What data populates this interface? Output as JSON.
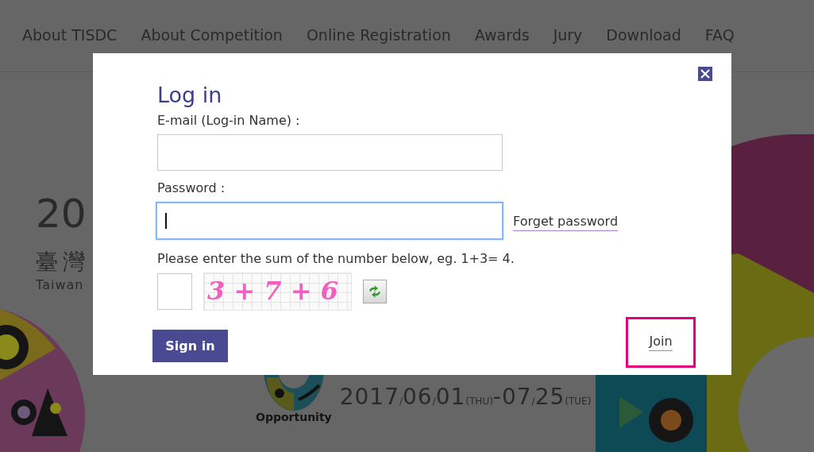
{
  "nav": {
    "items": [
      {
        "label": "About TISDC"
      },
      {
        "label": "About Competition"
      },
      {
        "label": "Online Registration"
      },
      {
        "label": "Awards"
      },
      {
        "label": "Jury"
      },
      {
        "label": "Download"
      },
      {
        "label": "FAQ"
      }
    ]
  },
  "hero": {
    "year": "20",
    "title_zh": "臺灣",
    "title_en": "Taiwan",
    "logo_caption": "Opportunity",
    "date": [
      {
        "text": "2017",
        "small": false
      },
      {
        "text": "/",
        "small": true
      },
      {
        "text": "06",
        "small": false
      },
      {
        "text": "/",
        "small": true
      },
      {
        "text": "01",
        "small": false
      },
      {
        "text": "(THU)",
        "small": true
      },
      {
        "text": "-07",
        "small": false
      },
      {
        "text": "/",
        "small": true
      },
      {
        "text": "25",
        "small": false
      },
      {
        "text": "(TUE)",
        "small": true
      }
    ]
  },
  "dialog": {
    "title": "Log in",
    "email": {
      "label": "E-mail (Log-in Name) :",
      "focused": false
    },
    "password": {
      "label": "Password :",
      "focused": true
    },
    "forgot_link": "Forget password",
    "captcha": {
      "label": "Please enter the sum of the number below, eg. 1+3= 4.",
      "challenge": "3 + 7 + 6"
    },
    "sign_in_button": "Sign in",
    "join_link": {
      "label": "Join",
      "highlighted": true
    }
  }
}
